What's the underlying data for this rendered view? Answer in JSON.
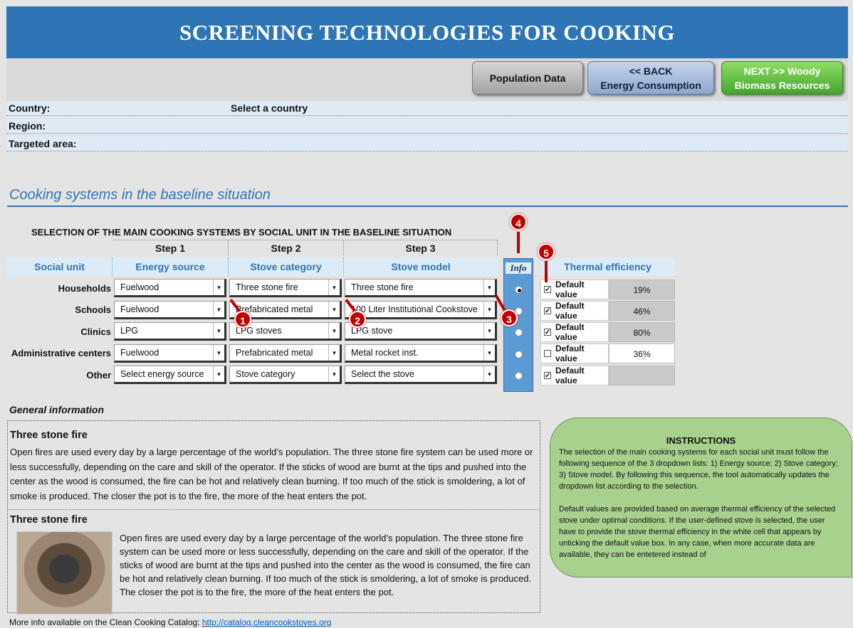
{
  "header": {
    "title": "SCREENING TECHNOLOGIES FOR COOKING"
  },
  "nav": {
    "population": "Population Data",
    "back_line1": "<< BACK",
    "back_line2": "Energy Consumption",
    "next_line1": "NEXT >> Woody",
    "next_line2": "Biomass Resources"
  },
  "location": {
    "country_label": "Country:",
    "country_value": "Select a country",
    "region_label": "Region:",
    "region_value": "",
    "area_label": "Targeted area:",
    "area_value": ""
  },
  "section_title": "Cooking systems in the baseline situation",
  "selection": {
    "title": "SELECTION OF THE MAIN COOKING SYSTEMS BY SOCIAL UNIT IN THE BASELINE SITUATION",
    "steps": [
      "Step 1",
      "Step 2",
      "Step 3"
    ],
    "headers": {
      "social_unit": "Social unit",
      "energy_source": "Energy source",
      "stove_category": "Stove category",
      "stove_model": "Stove model"
    },
    "rows": [
      {
        "unit": "Households",
        "energy": "Fuelwood",
        "category": "Three stone fire",
        "model": "Three stone fire",
        "info_selected": true
      },
      {
        "unit": "Schools",
        "energy": "Fuelwood",
        "category": "Prefabricated metal",
        "model": "100 Liter Institutional Cookstove",
        "info_selected": false
      },
      {
        "unit": "Clinics",
        "energy": "LPG",
        "category": "LPG stoves",
        "model": "LPG stove",
        "info_selected": false
      },
      {
        "unit": "Administrative centers",
        "energy": "Fuelwood",
        "category": "Prefabricated metal",
        "model": "Metal rocket inst.",
        "info_selected": false
      },
      {
        "unit": "Other",
        "energy": "Select energy source",
        "category": "Stove category",
        "model": "Select the stove",
        "info_selected": false
      }
    ]
  },
  "info": {
    "title": "Info"
  },
  "thermal": {
    "title": "Thermal efficiency",
    "rows": [
      {
        "label": "Default value",
        "checked": true,
        "value": "19%"
      },
      {
        "label": "Default value",
        "checked": true,
        "value": "46%"
      },
      {
        "label": "Default value",
        "checked": true,
        "value": "80%"
      },
      {
        "label": "Default value",
        "checked": false,
        "value": "36%"
      },
      {
        "label": "Default value",
        "checked": true,
        "value": ""
      }
    ]
  },
  "markers": [
    "1",
    "2",
    "3",
    "4",
    "5"
  ],
  "general": {
    "title": "General information",
    "h1": "Three stone fire",
    "p1": "Open fires are used every day by a large percentage of the world’s population. The three stone fire system can be used more or less successfully, depending on the care and skill of the operator. If the sticks of wood are burnt at the tips and pushed into the center as the wood is consumed, the fire can be hot and relatively clean burning. If too much of the stick is smoldering, a lot of smoke is produced. The closer the pot is to the fire, the more of the heat enters the pot.",
    "h2": "Three stone fire",
    "p2": "Open fires are used every day by a large percentage of the world’s population. The three stone fire system can be used more or less successfully, depending on the care and skill of the operator. If the sticks of wood are burnt at the tips and pushed into the center as the wood is consumed, the fire can be hot and relatively clean burning. If too much of the stick is smoldering, a lot of smoke is produced. The closer the pot is to the fire, the more of the heat enters the pot."
  },
  "more_info": {
    "text": "More info available on the Clean Cooking Catalog: ",
    "link": "http://catalog.cleancookstoves.org"
  },
  "instructions": {
    "title": "INSTRUCTIONS",
    "p1": "The selection of the main cooking systems for each social unit must follow the following sequence of the 3 dropdown lists: 1) Energy source; 2) Stove category; 3) Stove model. By following this sequence, the tool automatically updates the dropdown list according to the selection.",
    "p2": "Default values are provided based on average thermal efficiency of the selected stove under optimal conditions. If the user-defined stove is selected, the user have to provide the stove thermal efficiency in the white cell that appears by unticking the default value box. In any case, when more accurate data are available, they can be entetered instead of"
  }
}
